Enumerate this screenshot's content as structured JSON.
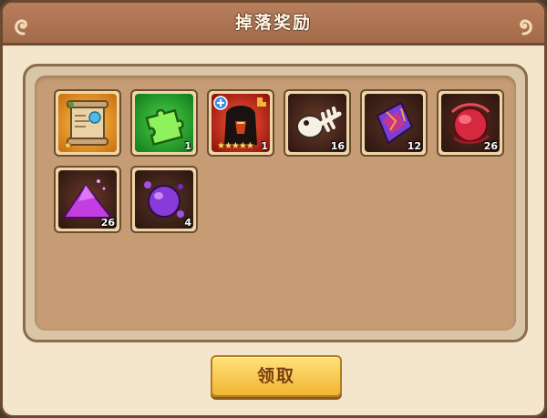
{
  "dialog": {
    "title": "掉落奖励",
    "claim_label": "领取"
  },
  "items": [
    {
      "icon": "scroll-map-icon",
      "count": "",
      "star_count": "★"
    },
    {
      "icon": "green-puzzle-icon",
      "count": "1"
    },
    {
      "icon": "hooded-hero-icon",
      "count": "1",
      "stars": "★★★★★"
    },
    {
      "icon": "fish-bone-icon",
      "count": "16"
    },
    {
      "icon": "purple-crystal-icon",
      "count": "12"
    },
    {
      "icon": "red-orb-icon",
      "count": "26"
    },
    {
      "icon": "purple-powder-icon",
      "count": "26"
    },
    {
      "icon": "purple-gem-icon",
      "count": "4"
    }
  ],
  "colors": {
    "title_bar": "#a36a49",
    "panel_fill": "#c69c74",
    "button": "#f1b533"
  }
}
